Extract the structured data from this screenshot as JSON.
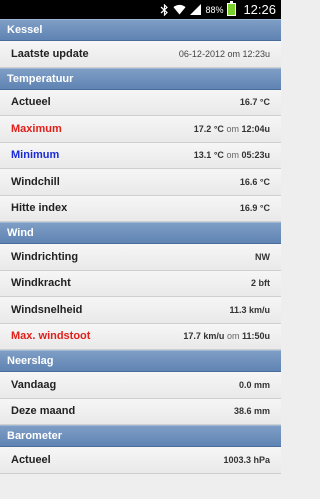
{
  "status_bar": {
    "battery_percent": "88%",
    "time": "12:26",
    "icons": [
      "bluetooth-icon",
      "wifi-icon",
      "signal-icon",
      "battery-icon"
    ]
  },
  "sections": {
    "kessel": {
      "title": "Kessel",
      "last_update_label": "Laatste update",
      "last_update_value": "06-12-2012 om 12:23u"
    },
    "temperatuur": {
      "title": "Temperatuur",
      "actueel_label": "Actueel",
      "actueel_value": "16.7 °C",
      "maximum_label": "Maximum",
      "maximum_value": "17.2 °C",
      "maximum_sep": "om",
      "maximum_time": "12:04u",
      "minimum_label": "Minimum",
      "minimum_value": "13.1 °C",
      "minimum_sep": "om",
      "minimum_time": "05:23u",
      "windchill_label": "Windchill",
      "windchill_value": "16.6 °C",
      "hitte_label": "Hitte index",
      "hitte_value": "16.9 °C"
    },
    "wind": {
      "title": "Wind",
      "richting_label": "Windrichting",
      "richting_value": "NW",
      "kracht_label": "Windkracht",
      "kracht_value": "2 bft",
      "snelheid_label": "Windsnelheid",
      "snelheid_value": "11.3 km/u",
      "max_label": "Max. windstoot",
      "max_value": "17.7 km/u",
      "max_sep": "om",
      "max_time": "11:50u"
    },
    "neerslag": {
      "title": "Neerslag",
      "vandaag_label": "Vandaag",
      "vandaag_value": "0.0 mm",
      "maand_label": "Deze maand",
      "maand_value": "38.6 mm"
    },
    "barometer": {
      "title": "Barometer",
      "actueel_label": "Actueel",
      "actueel_value": "1003.3 hPa"
    }
  },
  "colors": {
    "section_header": "#6a8dbd",
    "highlight_red": "#e0201b",
    "highlight_blue": "#1a2bd6",
    "battery": "#7bd12b"
  }
}
